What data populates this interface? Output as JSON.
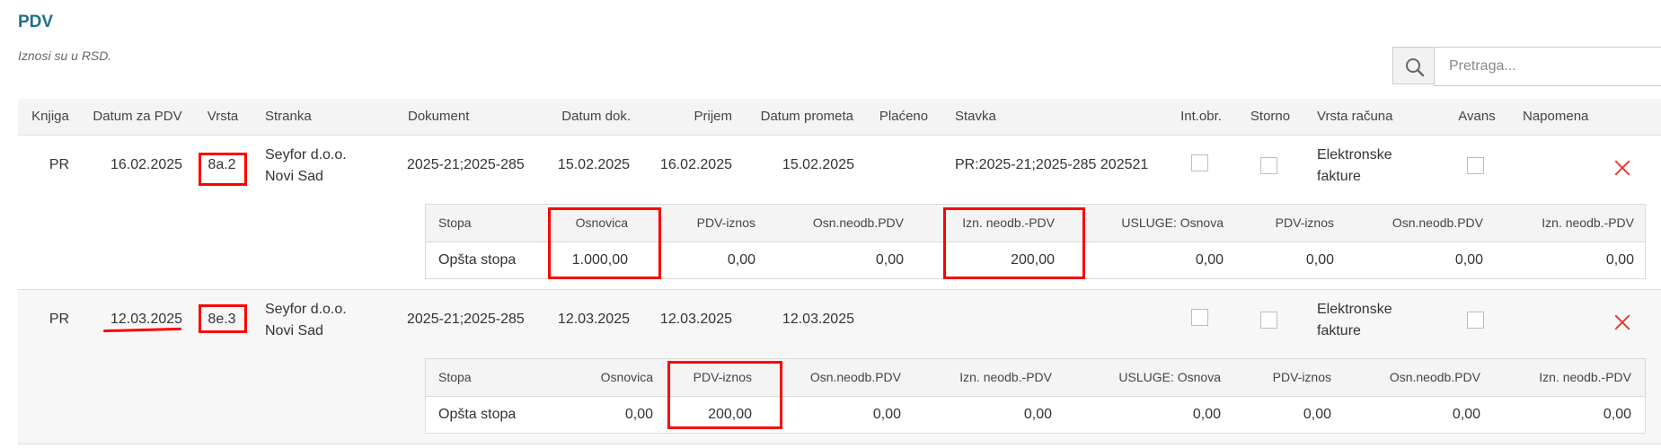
{
  "page": {
    "title": "PDV",
    "subtitle": "Iznosi su u RSD."
  },
  "search": {
    "placeholder": "Pretraga..."
  },
  "columns": {
    "knjiga": "Knjiga",
    "datum_pdv": "Datum za PDV",
    "vrsta": "Vrsta",
    "stranka": "Stranka",
    "dokument": "Dokument",
    "datum_dok": "Datum dok.",
    "prijem": "Prijem",
    "datum_prometa": "Datum prometa",
    "placeno": "Plaćeno",
    "stavka": "Stavka",
    "int_obr": "Int.obr.",
    "storno": "Storno",
    "vrsta_racuna": "Vrsta računa",
    "avans": "Avans",
    "napomena": "Napomena"
  },
  "sub_columns": {
    "stopa": "Stopa",
    "osnovica": "Osnovica",
    "pdv_iznos": "PDV-iznos",
    "osn_neodb": "Osn.neodb.PDV",
    "izn_neodb": "Izn. neodb.-PDV",
    "usluge_osnova": "USLUGE: Osnova",
    "pdv_iznos2": "PDV-iznos",
    "osn_neodb2": "Osn.neodb.PDV",
    "izn_neodb2": "Izn. neodb.-PDV"
  },
  "rows": [
    {
      "knjiga": "PR",
      "datum_pdv": "16.02.2025",
      "vrsta": "8a.2",
      "stranka_l1": "Seyfor d.o.o.",
      "stranka_l2": "Novi Sad",
      "dokument": "2025-21;2025-285",
      "datum_dok": "15.02.2025",
      "prijem": "16.02.2025",
      "datum_prometa": "15.02.2025",
      "stavka": "PR:2025-21;2025-285 202521",
      "vrsta_racuna_l1": "Elektronske",
      "vrsta_racuna_l2": "fakture",
      "sub": {
        "stopa": "Opšta stopa",
        "osnovica": "1.000,00",
        "pdv_iznos": "0,00",
        "osn_neodb": "0,00",
        "izn_neodb": "200,00",
        "usluge_osnova": "0,00",
        "pdv_iznos2": "0,00",
        "osn_neodb2": "0,00",
        "izn_neodb2": "0,00"
      }
    },
    {
      "knjiga": "PR",
      "datum_pdv": "12.03.2025",
      "vrsta": "8e.3",
      "stranka_l1": "Seyfor d.o.o.",
      "stranka_l2": "Novi Sad",
      "dokument": "2025-21;2025-285",
      "datum_dok": "12.03.2025",
      "prijem": "12.03.2025",
      "datum_prometa": "12.03.2025",
      "stavka": "",
      "vrsta_racuna_l1": "Elektronske",
      "vrsta_racuna_l2": "fakture",
      "sub": {
        "stopa": "Opšta stopa",
        "osnovica": "0,00",
        "pdv_iznos": "200,00",
        "osn_neodb": "0,00",
        "izn_neodb": "0,00",
        "usluge_osnova": "0,00",
        "pdv_iznos2": "0,00",
        "osn_neodb2": "0,00",
        "izn_neodb2": "0,00"
      }
    }
  ],
  "colors": {
    "title": "#1f6f8b",
    "highlight": "#ff0000",
    "delete": "#e53935"
  },
  "icons": {
    "search": "search-icon",
    "delete": "close-icon"
  }
}
